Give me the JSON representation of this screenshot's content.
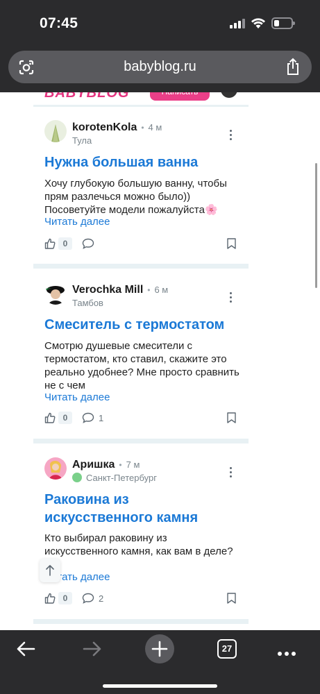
{
  "status": {
    "time": "07:45"
  },
  "browser": {
    "url": "babyblog.ru",
    "tab_count": "27"
  },
  "site": {
    "logo": "BABYBLOG",
    "write_label": "Написать"
  },
  "posts": [
    {
      "author": "korotenKola",
      "time": "4 м",
      "city": "Тула",
      "title": "Нужна большая ванна",
      "body": "Хочу глубокую большую ванну, чтобы прям разлечься можно было)) Посоветуйте модели пожалуйста🌸",
      "read_more": "Читать далее",
      "likes": "0",
      "comments": ""
    },
    {
      "author": "Verochka Mill",
      "time": "6 м",
      "city": "Тамбов",
      "title": "Смеситель с термостатом",
      "body": "Смотрю душевые смесители с термостатом, кто ставил, скажите это реально удобнее? Мне просто сравнить не с чем",
      "read_more": "Читать далее",
      "likes": "0",
      "comments": "1"
    },
    {
      "author": "Аришка",
      "time": "7 м",
      "city": "Санкт-Петербург",
      "title": "Раковина из искусственного камня",
      "body": "Кто выбирал раковину из искусственного камня, как вам в деле?",
      "read_more": "Читать далее",
      "likes": "0",
      "comments": "2"
    }
  ],
  "colors": {
    "accent": "#1b79d6",
    "brand": "#ea3f88",
    "chrome": "#2b2b2d"
  }
}
